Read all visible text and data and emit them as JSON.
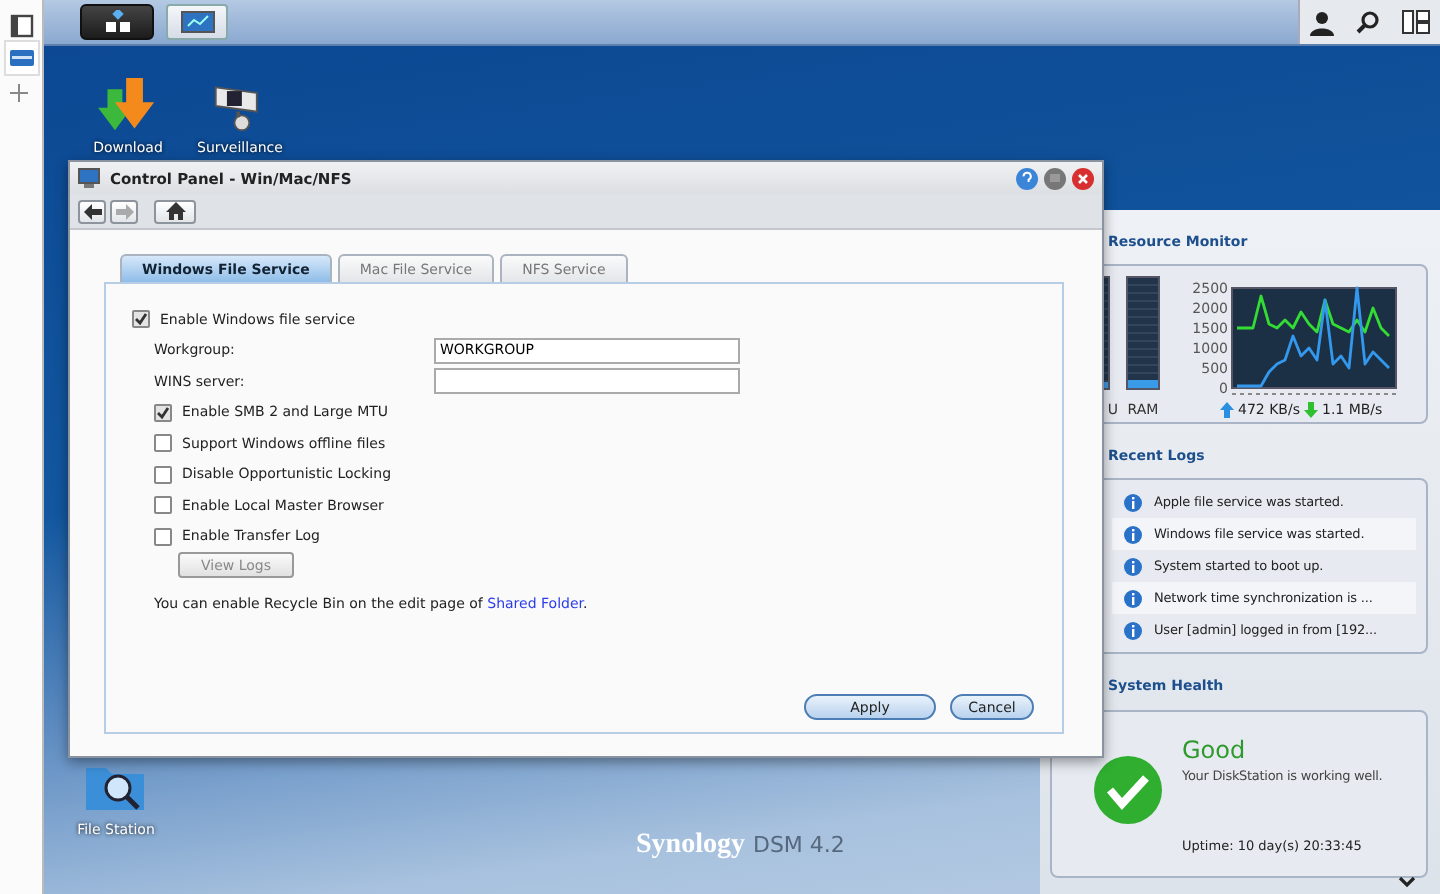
{
  "desktop_icons": [
    {
      "label": "Download",
      "kind": "download"
    },
    {
      "label": "Surveillance",
      "kind": "camera"
    },
    {
      "label": "File Station",
      "kind": "folder"
    }
  ],
  "window": {
    "title": "Control Panel - Win/Mac/NFS",
    "toolbar": [
      {
        "kind": "back",
        "disabled": false
      },
      {
        "kind": "forward",
        "disabled": true
      },
      {
        "kind": "home",
        "disabled": false
      }
    ],
    "tabs": [
      {
        "label": "Windows File Service",
        "selected": true
      },
      {
        "label": "Mac File Service",
        "selected": false
      },
      {
        "label": "NFS Service",
        "selected": false
      }
    ],
    "enable_service": {
      "label": "Enable Windows file service",
      "checked": true
    },
    "fields": [
      {
        "label": "Workgroup:",
        "value": "WORKGROUP"
      },
      {
        "label": "WINS server:"
      }
    ],
    "options": [
      {
        "label": "Enable SMB 2 and Large MTU",
        "checked": true
      },
      {
        "label": "Support Windows offline files",
        "checked": false
      },
      {
        "label": "Disable Opportunistic Locking",
        "checked": false
      },
      {
        "label": "Enable Local Master Browser",
        "checked": false
      },
      {
        "label": "Enable Transfer Log",
        "checked": false
      }
    ],
    "view_logs": {
      "label": "View Logs",
      "disabled": true
    },
    "note": {
      "text": "You can enable Recycle Bin on the edit page of ",
      "link": "Shared Folder",
      "after": "."
    },
    "buttons": [
      "Apply",
      "Cancel"
    ]
  },
  "resource_monitor": {
    "title": "Resource Monitor",
    "cpu": {
      "label": "U",
      "level": 0.05
    },
    "ram": {
      "label": "RAM",
      "level": 0.07
    },
    "chart_data": {
      "type": "line",
      "ylim": [
        0,
        2500
      ],
      "yticks": [
        0,
        500,
        1000,
        1500,
        2000,
        2500
      ],
      "series": [
        {
          "color": "#33dd33",
          "values": [
            1500,
            1500,
            1500,
            2300,
            1600,
            1500,
            1700,
            1500,
            1900,
            1600,
            1400,
            2200,
            1600,
            1500,
            1400,
            1700,
            1400,
            2000,
            1500,
            1300
          ]
        },
        {
          "color": "#3399ee",
          "values": [
            50,
            50,
            50,
            50,
            400,
            600,
            700,
            1300,
            800,
            1000,
            700,
            2200,
            600,
            800,
            500,
            2500,
            600,
            900,
            700,
            500
          ]
        }
      ]
    },
    "upload": "472 KB/s",
    "download": "1.1 MB/s"
  },
  "recent_logs": {
    "title": "Recent Logs",
    "items": [
      "Apple file service was started.",
      "Windows file service was started.",
      "System started to boot up.",
      "Network time synchronization is ...",
      "User [admin] logged in from [192..."
    ]
  },
  "system_health": {
    "title": "System Health",
    "status": "Good",
    "message": "Your DiskStation is working well.",
    "uptime": "Uptime: 10 day(s) 20:33:45"
  },
  "logo": {
    "brand": "Synology",
    "version": "DSM 4.2"
  }
}
